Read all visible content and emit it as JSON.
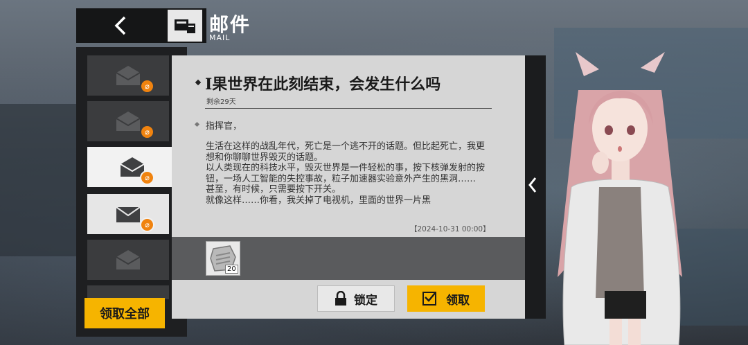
{
  "header": {
    "back_icon": "chevron-left-icon",
    "title": "邮件",
    "subtitle": "MAIL"
  },
  "mail_list": {
    "items": [
      {
        "icon": "envelope-open-icon",
        "has_attachment": true,
        "state": "read"
      },
      {
        "icon": "envelope-open-icon",
        "has_attachment": true,
        "state": "read"
      },
      {
        "icon": "envelope-open-icon",
        "has_attachment": true,
        "state": "selected"
      },
      {
        "icon": "envelope-closed-icon",
        "has_attachment": true,
        "state": "unread"
      },
      {
        "icon": "envelope-open-icon",
        "has_attachment": false,
        "state": "read"
      }
    ],
    "claim_all_label": "领取全部"
  },
  "mail": {
    "title": "I果世界在此刻结束，会发生什么吗",
    "remaining": "剩余29天",
    "greeting": "指挥官，",
    "body": [
      "生活在这样的战乱年代，死亡是一个逃不开的话题。但比起死亡，我更想和你聊聊世界毁灭的话题。",
      "以人类现在的科技水平，毁灭世界是一件轻松的事，按下核弹发射的按钮，一场人工智能的失控事故，粒子加速器实验意外产生的黑洞……",
      "甚至，有时候，只需要按下开关。",
      "就像这样……你看，我关掉了电视机，里面的世界一片黑"
    ],
    "date": "【2024-10-31 00:00】",
    "attachment": {
      "icon": "material-chip-icon",
      "count": "20"
    }
  },
  "actions": {
    "lock_label": "锁定",
    "claim_label": "领取"
  },
  "colors": {
    "accent": "#f6b400",
    "badge": "#f0830f"
  }
}
